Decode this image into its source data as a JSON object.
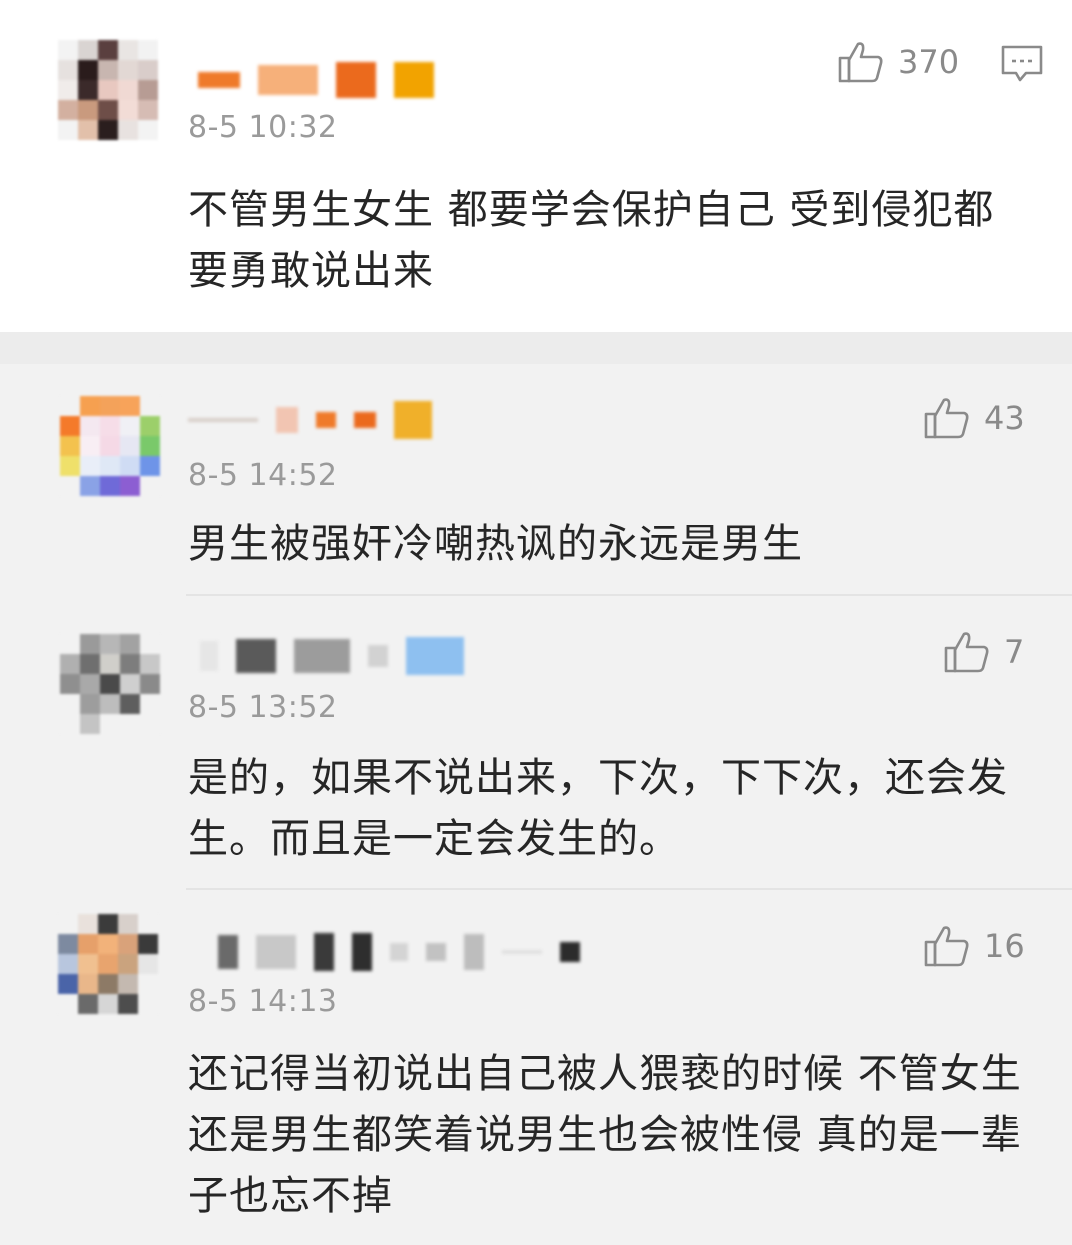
{
  "comments": [
    {
      "time": "8-5 10:32",
      "likes": "370",
      "text": "不管男生女生 都要学会保护自己 受到侵犯都要勇敢说出来",
      "like_icon": "thumbs-up-icon",
      "reply_icon": "comment-reply-icon"
    },
    {
      "time": "8-5 14:52",
      "likes": "43",
      "text": "男生被强奸冷嘲热讽的永远是男生",
      "like_icon": "thumbs-up-icon"
    },
    {
      "time": "8-5 13:52",
      "likes": "7",
      "text": "是的，如果不说出来，下次，下下次，还会发生。而且是一定会发生的。",
      "like_icon": "thumbs-up-icon"
    },
    {
      "time": "8-5 14:13",
      "likes": "16",
      "text": "还记得当初说出自己被人猥亵的时候 不管女生还是男生都笑着说男生也会被性侵 真的是一辈子也忘不掉",
      "like_icon": "thumbs-up-icon"
    }
  ],
  "colors": {
    "background": "#f2f2f2",
    "card_background": "#ffffff",
    "text": "#262626",
    "meta_text": "#9a9a9a"
  }
}
